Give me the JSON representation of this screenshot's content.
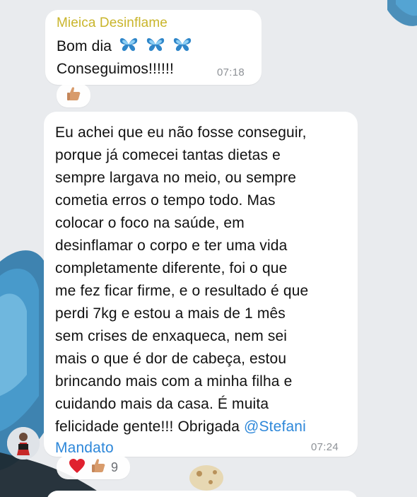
{
  "message1": {
    "sender": "Mieica Desinflame",
    "sender_color": "#c9b52b",
    "line1": "Bom dia",
    "line1_emoji": "butterfly-icon x3",
    "line2": "Conseguimos!!!!!!",
    "time": "07:18",
    "reactions": [
      {
        "icon": "thumbs-up-icon"
      }
    ]
  },
  "message2": {
    "lines": [
      "Eu achei que eu não fosse conseguir,",
      "porque já comecei tantas dietas e",
      "sempre largava no meio, ou sempre",
      "cometia erros o tempo todo. Mas",
      "colocar o foco na saúde, em",
      "desinflamar o corpo e ter uma vida",
      "completamente diferente, foi o que",
      "me fez ficar firme, e o resultado é que",
      "perdi 7kg e estou a mais de 1 mês",
      "sem crises de enxaqueca, nem sei",
      "mais o que é dor de cabeça, estou",
      "brincando mais com a minha filha e",
      "cuidando mais da casa. É muita"
    ],
    "line14_text": "felicidade gente!!! Obrigada ",
    "mention_line1": "@Stefani",
    "mention_line2": "Mandato",
    "mention_color": "#2d87d9",
    "time": "07:24",
    "reactions": [
      {
        "icon": "red-heart-icon"
      },
      {
        "icon": "thumbs-up-icon"
      }
    ],
    "reaction_count": "9"
  },
  "colors": {
    "wallpaper": "#e9ebee",
    "bubble": "#ffffff",
    "accent_butterfly": "#2f86c9"
  }
}
